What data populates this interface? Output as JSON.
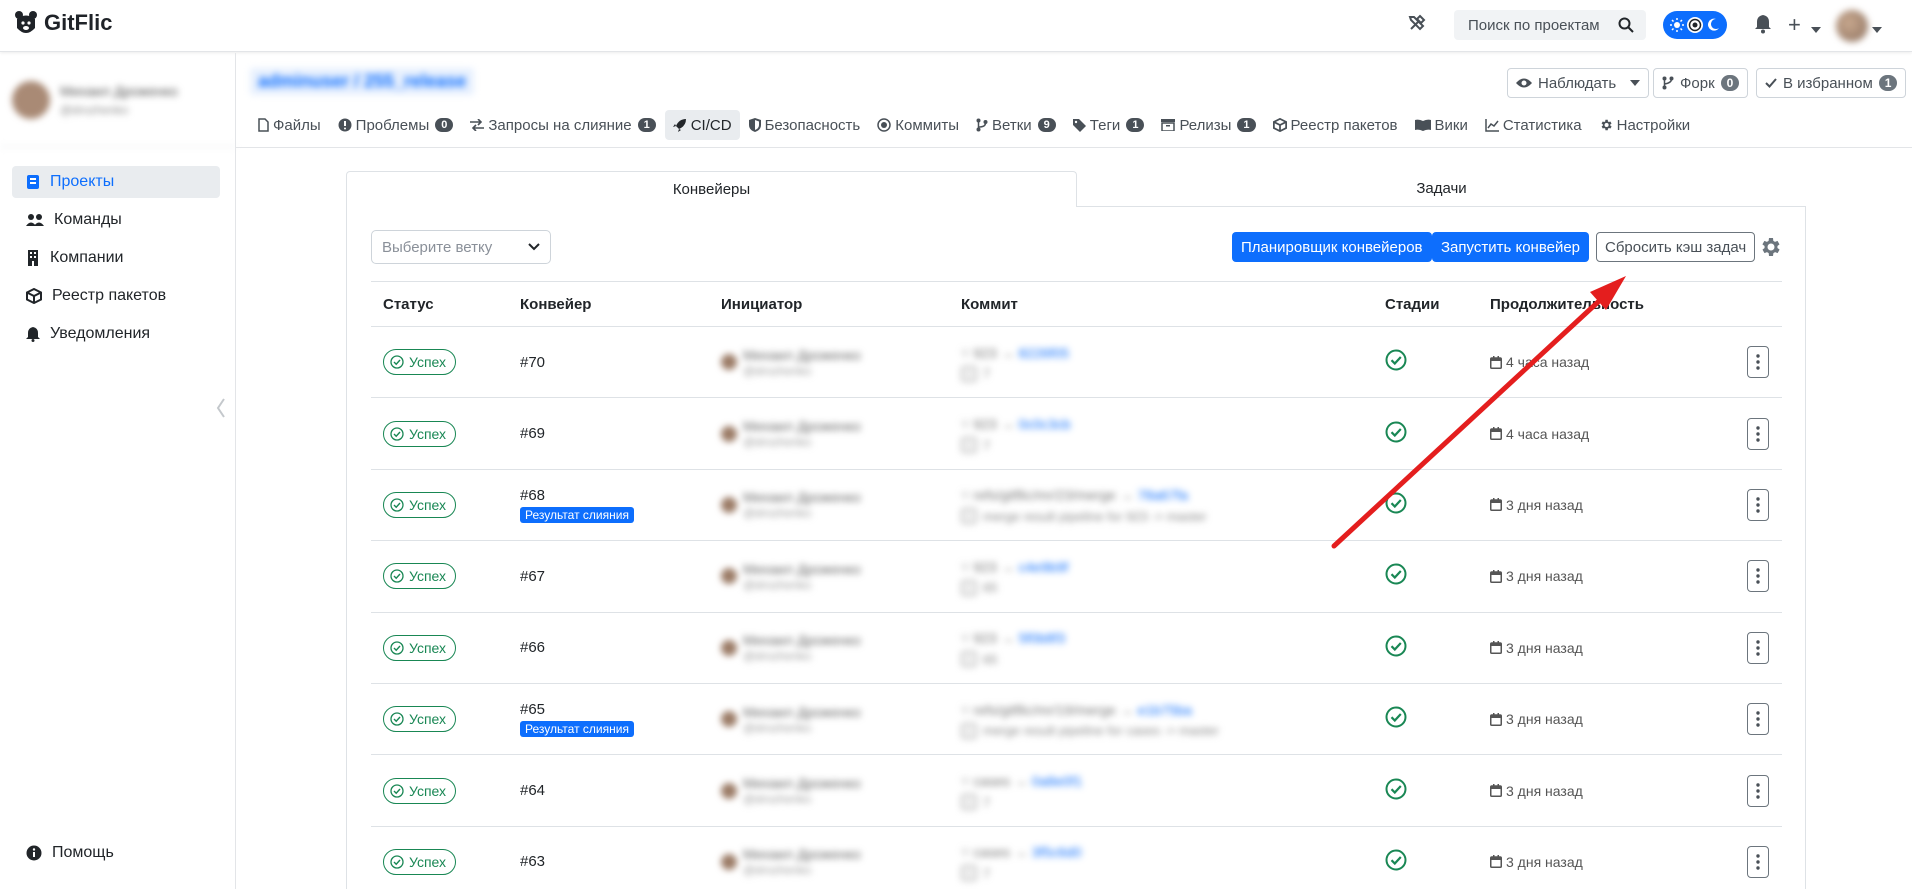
{
  "app": {
    "name": "GitFlic"
  },
  "header": {
    "search_placeholder": "Поиск по проектам"
  },
  "user": {
    "name": "Михаил Дроженко",
    "sub": "@drozhenko"
  },
  "sidebar": {
    "items": [
      {
        "label": "Проекты",
        "icon": "book-icon",
        "active": true
      },
      {
        "label": "Команды",
        "icon": "users-icon",
        "active": false
      },
      {
        "label": "Компании",
        "icon": "building-icon",
        "active": false
      },
      {
        "label": "Реестр пакетов",
        "icon": "package-icon",
        "active": false
      },
      {
        "label": "Уведомления",
        "icon": "bell-icon",
        "active": false
      }
    ],
    "help": "Помощь"
  },
  "repo": {
    "title": "adminuser / 255_release",
    "watch_label": "Наблюдать",
    "fork_label": "Форк",
    "fork_count": "0",
    "star_label": "В избранном",
    "star_count": "1"
  },
  "nav": [
    {
      "label": "Файлы",
      "icon": "file-icon"
    },
    {
      "label": "Проблемы",
      "icon": "issue-icon",
      "badge": "0"
    },
    {
      "label": "Запросы на слияние",
      "icon": "merge-icon",
      "badge": "1"
    },
    {
      "label": "CI/CD",
      "icon": "rocket-icon",
      "active": true
    },
    {
      "label": "Безопасность",
      "icon": "shield-icon"
    },
    {
      "label": "Коммиты",
      "icon": "commit-icon"
    },
    {
      "label": "Ветки",
      "icon": "branch-icon",
      "badge": "9"
    },
    {
      "label": "Теги",
      "icon": "tag-icon",
      "badge": "1"
    },
    {
      "label": "Релизы",
      "icon": "release-icon",
      "badge": "1"
    },
    {
      "label": "Реестр пакетов",
      "icon": "package-icon"
    },
    {
      "label": "Вики",
      "icon": "wiki-icon"
    },
    {
      "label": "Статистика",
      "icon": "chart-icon"
    },
    {
      "label": "Настройки",
      "icon": "gear-icon"
    }
  ],
  "tabs": {
    "pipelines": "Конвейеры",
    "jobs": "Задачи"
  },
  "toolbar": {
    "branch_placeholder": "Выберите ветку",
    "scheduler": "Планировщик конвейеров",
    "run": "Запустить конвейер",
    "reset_cache": "Сбросить кэш задач"
  },
  "table": {
    "headers": {
      "status": "Статус",
      "pipeline": "Конвейер",
      "initiator": "Инициатор",
      "commit": "Коммит",
      "stages": "Стадии",
      "duration": "Продолжительность"
    },
    "rows": [
      {
        "status": "Успех",
        "id": "#70",
        "merge": "",
        "init": "Михаил Дроженко",
        "init_sub": "@drozhenko",
        "branch": "923",
        "hash": "8226f05",
        "msg": "7",
        "dur": "4 часа назад"
      },
      {
        "status": "Успех",
        "id": "#69",
        "merge": "",
        "init": "Михаил Дроженко",
        "init_sub": "@drozhenko",
        "branch": "923",
        "hash": "0c0c3cb",
        "msg": "7",
        "dur": "4 часа назад"
      },
      {
        "status": "Успех",
        "id": "#68",
        "merge": "Результат слияния",
        "init": "Михаил Дроженко",
        "init_sub": "@drozhenko",
        "branch": "refs/gitflic/mr/23/merge",
        "hash": "78a67fa",
        "msg": "merge result pipeline for 923 -> master",
        "dur": "3 дня назад"
      },
      {
        "status": "Успех",
        "id": "#67",
        "merge": "",
        "init": "Михаил Дроженко",
        "init_sub": "@drozhenko",
        "branch": "923",
        "hash": "c4e9b9f",
        "msg": "65",
        "dur": "3 дня назад"
      },
      {
        "status": "Успех",
        "id": "#66",
        "merge": "",
        "init": "Михаил Дроженко",
        "init_sub": "@drozhenko",
        "branch": "923",
        "hash": "5f0b8f3",
        "msg": "65",
        "dur": "3 дня назад"
      },
      {
        "status": "Успех",
        "id": "#65",
        "merge": "Результат слияния",
        "init": "Михаил Дроженко",
        "init_sub": "@drozhenko",
        "branch": "refs/gitflic/mr/19/merge",
        "hash": "e1b75ba",
        "msg": "merge result pipeline for cases -> master",
        "dur": "3 дня назад"
      },
      {
        "status": "Успех",
        "id": "#64",
        "merge": "",
        "init": "Михаил Дроженко",
        "init_sub": "@drozhenko",
        "branch": "cases",
        "hash": "0a8e0f1",
        "msg": "7",
        "dur": "3 дня назад"
      },
      {
        "status": "Успех",
        "id": "#63",
        "merge": "",
        "init": "Михаил Дроженко",
        "init_sub": "@drozhenko",
        "branch": "cases",
        "hash": "3f5c6d0",
        "msg": "7",
        "dur": "3 дня назад"
      }
    ]
  },
  "colors": {
    "accent": "#0d6efd",
    "success": "#198754",
    "arrow": "#e41e1e"
  }
}
